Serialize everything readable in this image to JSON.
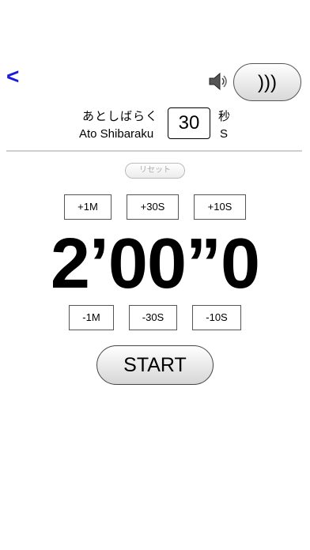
{
  "nav": {
    "back_label": "<"
  },
  "sound": {
    "button_label": ")))",
    "speaker_icon": "speaker-icon"
  },
  "remaining": {
    "label_jp": "あとしばらく",
    "label_romaji": "Ato Shibaraku",
    "seconds_value": "30",
    "unit_jp": "秒",
    "unit_en": "S"
  },
  "reset_label": "リセット",
  "increment_buttons": [
    "+1M",
    "+30S",
    "+10S"
  ],
  "timer_display": "2’00”0",
  "decrement_buttons": [
    "-1M",
    "-30S",
    "-10S"
  ],
  "start_label": "START",
  "colors": {
    "accent": "#1a1adb",
    "background": "#ffffff",
    "divider": "#cfcfcf"
  }
}
